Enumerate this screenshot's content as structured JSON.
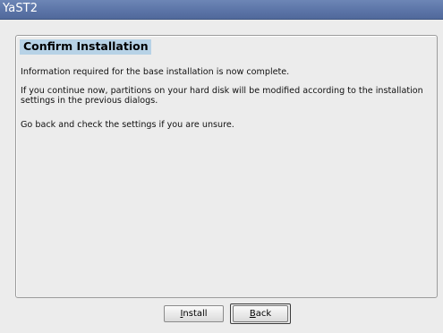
{
  "window": {
    "title": "YaST2"
  },
  "dialog": {
    "heading": "Confirm Installation",
    "paragraphs": [
      "Information required for the base installation is now complete.",
      "If you continue now, partitions on your hard disk will be modified according to the installation settings in the previous dialogs.",
      "Go back and check the settings if you are unsure."
    ]
  },
  "buttons": {
    "install": {
      "mnemonic": "I",
      "rest": "nstall"
    },
    "back": {
      "mnemonic": "B",
      "rest": "ack",
      "is_default": true
    }
  },
  "colors": {
    "titlebar": "#5a73a6",
    "heading_highlight": "#b7d2e6",
    "background": "#ececec"
  }
}
